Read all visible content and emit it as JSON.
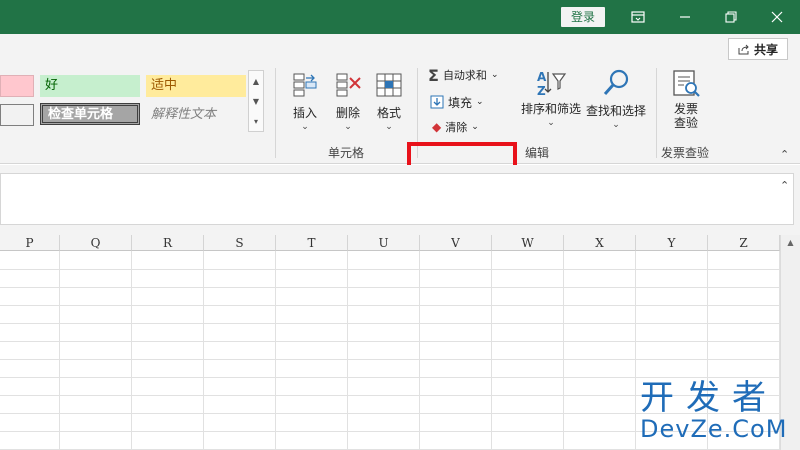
{
  "titlebar": {
    "login_label": "登录"
  },
  "share": {
    "label": "共享"
  },
  "styles": {
    "good": "好",
    "neutral": "适中",
    "check_cell": "检查单元格",
    "explanatory": "解释性文本"
  },
  "cells_group": {
    "insert": "插入",
    "delete": "删除",
    "format": "格式",
    "label": "单元格"
  },
  "editing_group": {
    "autosum": "自动求和",
    "fill": "填充",
    "clear": "清除",
    "sort_filter": "排序和筛选",
    "find_select": "查找和选择",
    "label": "编辑"
  },
  "invoice_group": {
    "button_line1": "发票",
    "button_line2": "查验",
    "label": "发票查验"
  },
  "columns": [
    "P",
    "Q",
    "R",
    "S",
    "T",
    "U",
    "V",
    "W",
    "X",
    "Y",
    "Z"
  ],
  "watermark": {
    "cn": "开发者",
    "en": "DevZe.CoM"
  },
  "colors": {
    "accent": "#217346",
    "highlight": "#e8111a",
    "good_bg": "#c6efce",
    "neutral_bg": "#ffeb9c",
    "bad_bg": "#ffc7ce"
  }
}
